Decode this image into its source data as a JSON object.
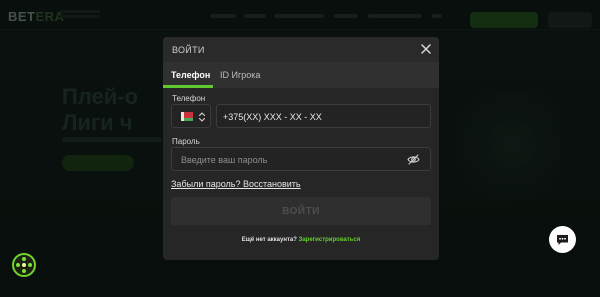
{
  "site": {
    "logo_text": "BET",
    "logo_accent": "ERA",
    "hero_line1": "Плей-о",
    "hero_line2": "Лиги ч"
  },
  "modal": {
    "title": "ВОЙТИ",
    "tabs": [
      "Телефон",
      "ID Игрока"
    ],
    "active_tab": "Телефон",
    "phone_label": "Телефон",
    "country": "Belarus",
    "phone_placeholder": "+375(XX) XXX - XX - XX",
    "password_label": "Пароль",
    "password_placeholder": "Введите ваш пароль",
    "forgot_link": "Забыли пароль? Восстановить",
    "submit_label": "ВОЙТИ",
    "no_account": "Ещё нет аккаунта?",
    "register_link": "Зарегистрироваться"
  },
  "icons": {
    "close": "close-icon",
    "eye": "eye-off-icon",
    "chevron": "chevron-updown-icon",
    "chat": "chat-icon",
    "wheel": "wheel-icon"
  },
  "colors": {
    "accent": "#61c930",
    "modal_bg": "#262626",
    "field_border": "#3c3c3c",
    "register_link": "#64d02e"
  }
}
